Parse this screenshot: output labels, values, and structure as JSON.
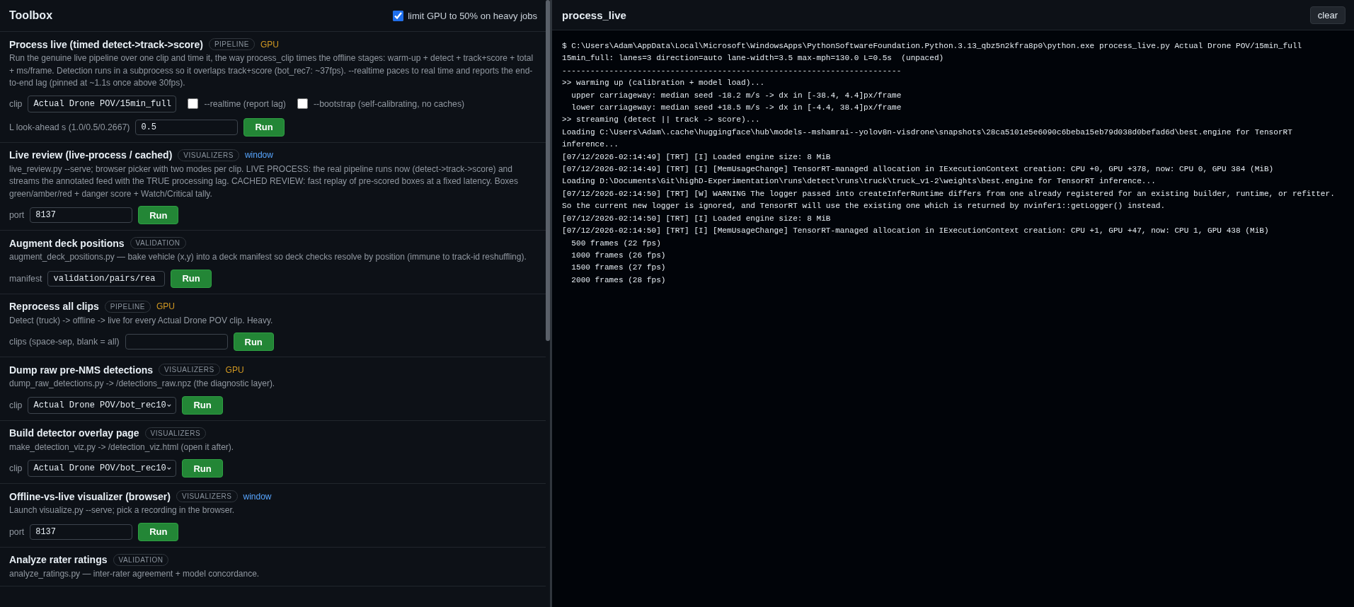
{
  "toolbox": {
    "title": "Toolbox",
    "gpu_limit": {
      "label": "limit GPU to 50% on heavy jobs",
      "checked": true
    },
    "sections": [
      {
        "title": "Process live (timed detect->track->score)",
        "tag": "PIPELINE",
        "flag": {
          "kind": "gpu",
          "text": "GPU"
        },
        "description": "Run the genuine live pipeline over one clip and time it, the way process_clip times the offline stages: warm-up + detect + track+score + total + ms/frame. Detection runs in a subprocess so it overlaps track+score (bot_rec7: ~37fps). --realtime paces to real time and reports the end-to-end lag (pinned at ~1.1s once above 30fps).",
        "rows": [
          [
            {
              "kind": "select",
              "label": "clip",
              "value": "Actual Drone POV/15min_full"
            },
            {
              "kind": "checkbox",
              "label": "--realtime (report lag)",
              "checked": false
            },
            {
              "kind": "checkbox",
              "label": "--bootstrap (self-calibrating, no caches)",
              "checked": false
            }
          ],
          [
            {
              "kind": "input",
              "label": "L look-ahead s (1.0/0.5/0.2667)",
              "value": "0.5"
            },
            {
              "kind": "run",
              "label": "Run"
            }
          ]
        ]
      },
      {
        "title": "Live review (live-process / cached)",
        "tag": "VISUALIZERS",
        "flag": {
          "kind": "window",
          "text": "window"
        },
        "description": "live_review.py --serve; browser picker with two modes per clip. LIVE PROCESS: the real pipeline runs now (detect->track->score) and streams the annotated feed with the TRUE processing lag. CACHED REVIEW: fast replay of pre-scored boxes at a fixed latency. Boxes green/amber/red + danger score + Watch/Critical tally.",
        "rows": [
          [
            {
              "kind": "input",
              "label": "port",
              "value": "8137"
            },
            {
              "kind": "run",
              "label": "Run"
            }
          ]
        ]
      },
      {
        "title": "Augment deck positions",
        "tag": "VALIDATION",
        "description": "augment_deck_positions.py — bake vehicle (x,y) into a deck manifest so deck checks resolve by position (immune to track-id reshuffling).",
        "rows": [
          [
            {
              "kind": "input",
              "label": "manifest",
              "value": "validation/pairs/rea"
            },
            {
              "kind": "run",
              "label": "Run"
            }
          ]
        ]
      },
      {
        "title": "Reprocess all clips",
        "tag": "PIPELINE",
        "flag": {
          "kind": "gpu",
          "text": "GPU"
        },
        "description": "Detect (truck) -> offline -> live for every Actual Drone POV clip. Heavy.",
        "rows": [
          [
            {
              "kind": "input",
              "label": "clips (space-sep, blank = all)"
            },
            {
              "kind": "run",
              "label": "Run"
            }
          ]
        ]
      },
      {
        "title": "Dump raw pre-NMS detections",
        "tag": "VISUALIZERS",
        "flag": {
          "kind": "gpu",
          "text": "GPU"
        },
        "description": "dump_raw_detections.py -> /detections_raw.npz (the diagnostic layer).",
        "rows": [
          [
            {
              "kind": "select",
              "label": "clip",
              "value": "Actual Drone POV/bot_rec10"
            },
            {
              "kind": "run",
              "label": "Run"
            }
          ]
        ]
      },
      {
        "title": "Build detector overlay page",
        "tag": "VISUALIZERS",
        "description": "make_detection_viz.py -> /detection_viz.html (open it after).",
        "rows": [
          [
            {
              "kind": "select",
              "label": "clip",
              "value": "Actual Drone POV/bot_rec10"
            },
            {
              "kind": "run",
              "label": "Run"
            }
          ]
        ]
      },
      {
        "title": "Offline-vs-live visualizer (browser)",
        "tag": "VISUALIZERS",
        "flag": {
          "kind": "window",
          "text": "window"
        },
        "description": "Launch visualize.py --serve; pick a recording in the browser.",
        "rows": [
          [
            {
              "kind": "input",
              "label": "port",
              "value": "8137"
            },
            {
              "kind": "run",
              "label": "Run"
            }
          ]
        ]
      },
      {
        "title": "Analyze rater ratings",
        "tag": "VALIDATION",
        "description": "analyze_ratings.py — inter-rater agreement + model concordance."
      }
    ]
  },
  "console": {
    "title": "process_live",
    "clear_button": "clear",
    "lines": [
      "$ C:\\Users\\Adam\\AppData\\Local\\Microsoft\\WindowsApps\\PythonSoftwareFoundation.Python.3.13_qbz5n2kfra8p0\\python.exe process_live.py Actual Drone POV/15min_full",
      "15min_full: lanes=3 direction=auto lane-width=3.5 max-mph=130.0 L=0.5s  (unpaced)",
      "------------------------------------------------------------------------",
      ">> warming up (calibration + model load)...",
      "  upper carriageway: median seed -18.2 m/s -> dx in [-38.4, 4.4]px/frame",
      "  lower carriageway: median seed +18.5 m/s -> dx in [-4.4, 38.4]px/frame",
      ">> streaming (detect || track -> score)...",
      "Loading C:\\Users\\Adam\\.cache\\huggingface\\hub\\models--mshamrai--yolov8n-visdrone\\snapshots\\28ca5101e5e6090c6beba15eb79d038d0befad6d\\best.engine for TensorRT inference...",
      "[07/12/2026-02:14:49] [TRT] [I] Loaded engine size: 8 MiB",
      "[07/12/2026-02:14:49] [TRT] [I] [MemUsageChange] TensorRT-managed allocation in IExecutionContext creation: CPU +0, GPU +378, now: CPU 0, GPU 384 (MiB)",
      "Loading D:\\Documents\\Git\\highD-Experimentation\\runs\\detect\\runs\\truck\\truck_v1-2\\weights\\best.engine for TensorRT inference...",
      "[07/12/2026-02:14:50] [TRT] [W] WARNING The logger passed into createInferRuntime differs from one already registered for an existing builder, runtime, or refitter. So the current new logger is ignored, and TensorRT will use the existing one which is returned by nvinfer1::getLogger() instead.",
      "[07/12/2026-02:14:50] [TRT] [I] Loaded engine size: 8 MiB",
      "[07/12/2026-02:14:50] [TRT] [I] [MemUsageChange] TensorRT-managed allocation in IExecutionContext creation: CPU +1, GPU +47, now: CPU 1, GPU 438 (MiB)",
      "  500 frames (22 fps)",
      "  1000 frames (26 fps)",
      "  1500 frames (27 fps)",
      "  2000 frames (28 fps)"
    ]
  }
}
